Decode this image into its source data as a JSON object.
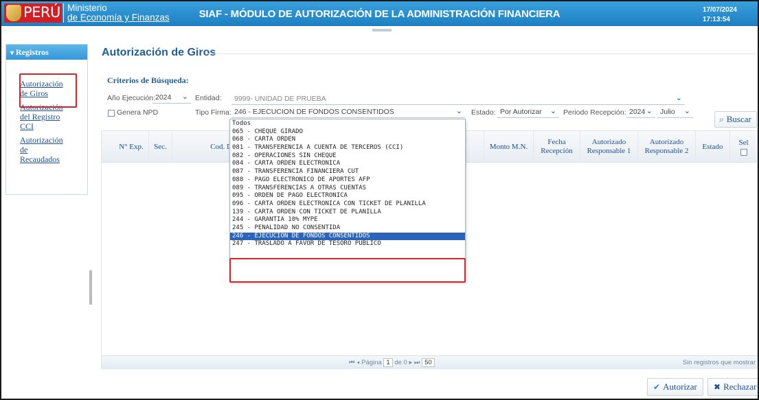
{
  "header": {
    "brand": "PERÚ",
    "ministry_line1": "Ministerio",
    "ministry_line2": "de Economía y Finanzas",
    "app_title": "SIAF - MÓDULO DE AUTORIZACIÓN DE LA ADMINISTRACIÓN FINANCIERA",
    "date": "17/07/2024",
    "time": "17:13:54"
  },
  "sidebar": {
    "title": "Registros",
    "items": [
      {
        "label_l1": "Autorización",
        "label_l2": "de Giros"
      },
      {
        "label_l1": "Autorización",
        "label_l2": "del Registro",
        "label_l3": "CCI"
      },
      {
        "label_l1": "Autorización",
        "label_l2": "de",
        "label_l3": "Recaudados"
      }
    ]
  },
  "page": {
    "title": "Autorización de Giros",
    "criteria_title": "Criterios de Búsqueda:"
  },
  "filters": {
    "year_label": "Año Ejecución:",
    "year_value": "2024",
    "entity_label": "Entidad:",
    "entity_value": "9999- UNIDAD DE PRUEBA",
    "npd_label": "Genera NPD",
    "firma_label": "Tipo Firma:",
    "firma_value": "246 - EJECUCION DE FONDOS CONSENTIDOS",
    "estado_label": "Estado:",
    "estado_value": "Por Autorizar",
    "periodo_label": "Periodo Recepción:",
    "periodo_year": "2024",
    "periodo_month": "Julio",
    "search_button": "Buscar"
  },
  "dropdown_options": [
    "Todos",
    "065 - CHEQUE GIRADO",
    "068 - CARTA ORDEN",
    "081 - TRANSFERENCIA A CUENTA DE TERCEROS (CCI)",
    "082 - OPERACIONES SIN CHEQUE",
    "084 - CARTA ORDEN ELECTRÓNICA",
    "087 - TRANSFERENCIA FINANCIERA CUT",
    "088 - PAGO ELECTRONICO DE APORTES AFP",
    "089 - TRANSFERENCIAS A OTRAS CUENTAS",
    "095 - ORDEN DE PAGO ELECTRÓNICA",
    "096 - CARTA ORDEN ELECTRÓNICA CON TICKET DE PLANILLA",
    "139 - CARTA ORDEN CON TICKET DE PLANILLA",
    "244 - GARANTIA 10% MYPE",
    "245 - PENALIDAD NO CONSENTIDA",
    "246 - EJECUCION DE FONDOS CONSENTIDOS",
    "247 - TRASLADO A FAVOR DE TESORO PUBLICO"
  ],
  "selected_option_index": 14,
  "grid": {
    "columns": {
      "nexp": "N° Exp.",
      "sec": "Sec.",
      "cod": "Cod. D",
      "monto": "Monto M.N.",
      "fecha_l1": "Fecha",
      "fecha_l2": "Recepción",
      "aut1_l1": "Autorizado",
      "aut1_l2": "Responsable 1",
      "aut2_l1": "Autorizado",
      "aut2_l2": "Responsable 2",
      "estado": "Estado",
      "sel": "Sel"
    },
    "pager": {
      "page_label": "Página",
      "page_value": "1",
      "of_label": "de 0",
      "page_size": "50"
    },
    "no_records": "Sin registros que mostrar"
  },
  "actions": {
    "authorize": "Autorizar",
    "reject": "Rechazar"
  },
  "colors": {
    "header_blue": "#1d7fc1",
    "title_blue": "#1f5f95",
    "highlight_red": "#d4232a",
    "selected_option": "#2a63b8"
  }
}
